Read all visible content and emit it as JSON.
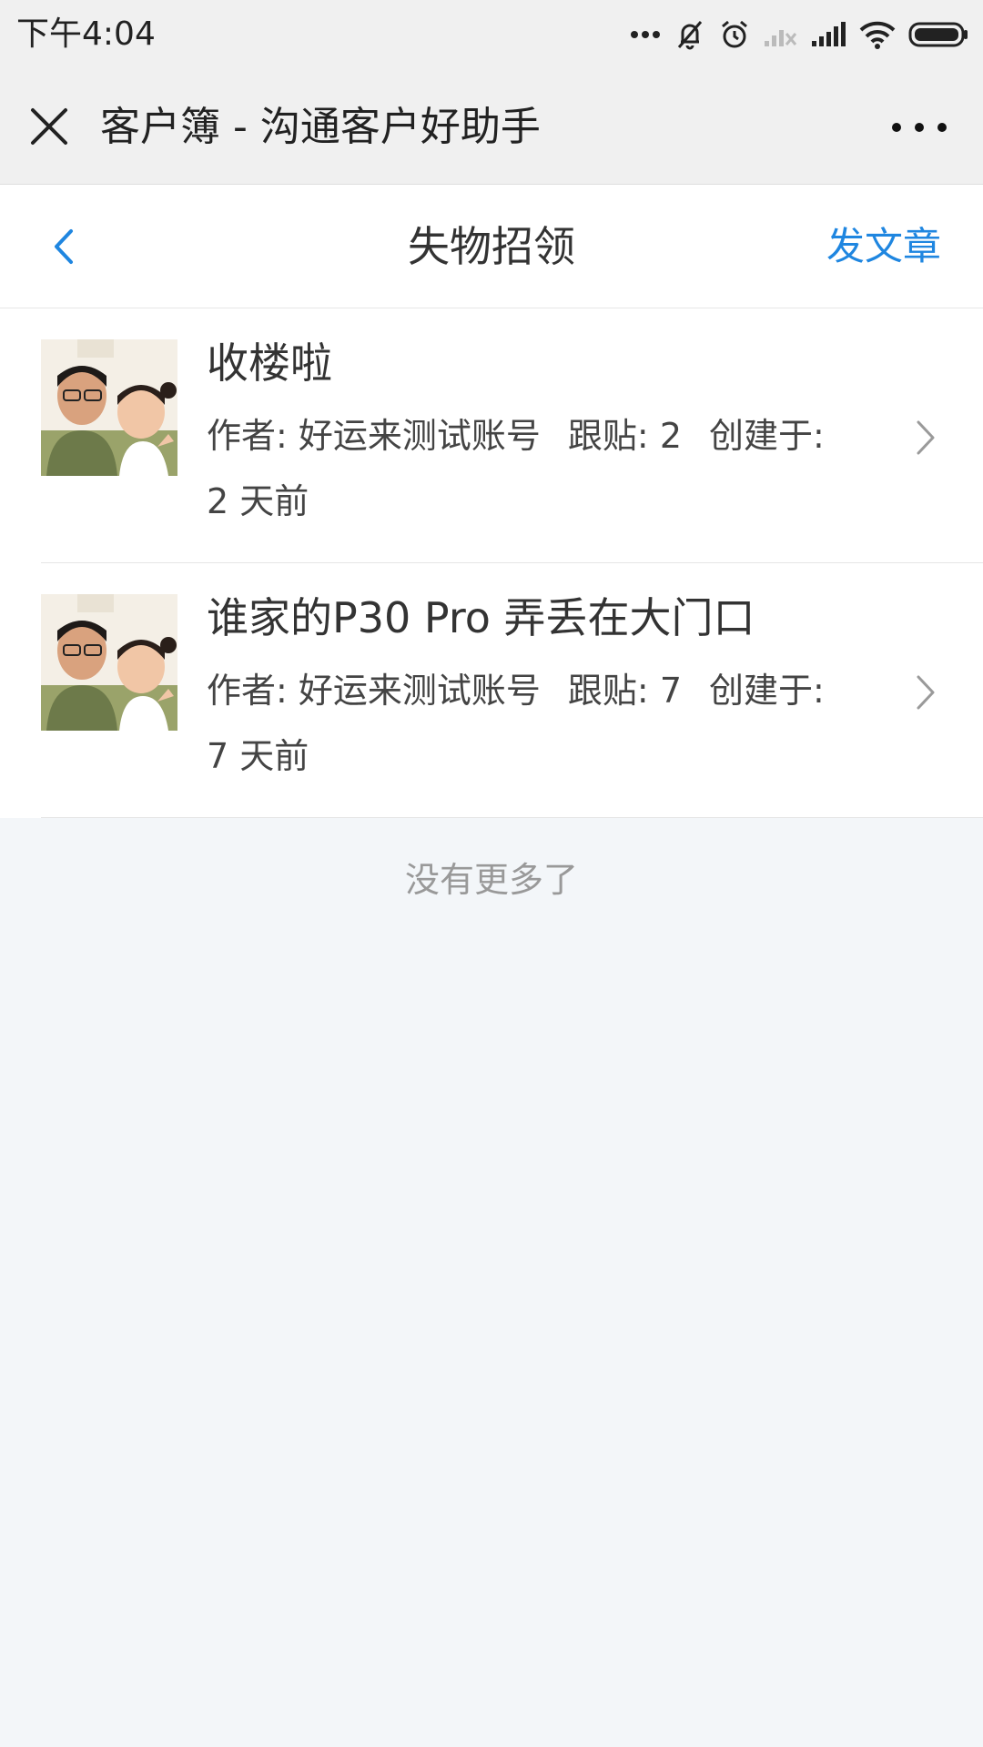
{
  "status_bar": {
    "time": "下午4:04"
  },
  "app_bar": {
    "title": "客户簿 - 沟通客户好助手"
  },
  "page_nav": {
    "title": "失物招领",
    "action_label": "发文章"
  },
  "posts": [
    {
      "title": "收楼啦",
      "author_label": "作者:",
      "author": "好运来测试账号",
      "replies_label": "跟贴:",
      "replies": "2",
      "created_label": "创建于:",
      "created": "2 天前"
    },
    {
      "title": "谁家的P30 Pro 弄丢在大门口",
      "author_label": "作者:",
      "author": "好运来测试账号",
      "replies_label": "跟贴:",
      "replies": "7",
      "created_label": "创建于:",
      "created": "7 天前"
    }
  ],
  "footer": {
    "no_more": "没有更多了"
  },
  "colors": {
    "accent": "#1f86e0",
    "status_bar_bg": "#f0f0f0",
    "page_bg": "#f3f6f9",
    "muted_text": "#999999"
  },
  "icons": {
    "close": "close-icon",
    "more": "more-icon",
    "back": "back-chevron-icon",
    "row_arrow": "chevron-right-icon"
  }
}
